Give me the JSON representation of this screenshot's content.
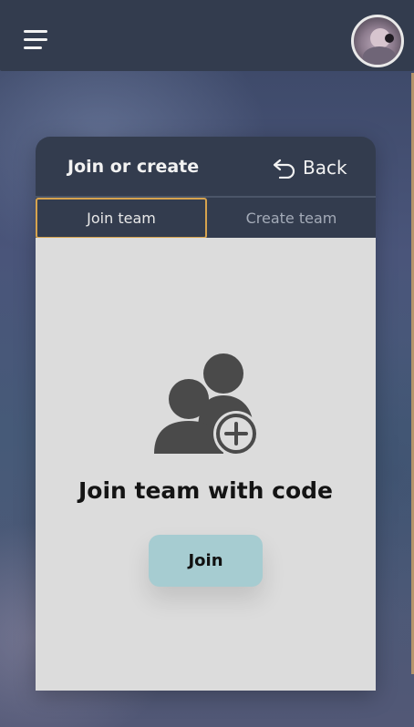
{
  "topbar": {
    "menu_icon": "hamburger-menu-icon",
    "avatar_icon": "user-avatar"
  },
  "panel": {
    "title": "Join or create",
    "back_label": "Back",
    "back_icon": "undo-arrow-icon"
  },
  "tabs": [
    {
      "label": "Join team",
      "active": true
    },
    {
      "label": "Create team",
      "active": false
    }
  ],
  "content": {
    "icon": "add-team-icon",
    "title": "Join team with code",
    "button_label": "Join"
  },
  "colors": {
    "header_bg": "#333c4e",
    "active_tab_border": "#d6a34e",
    "content_bg": "#dcdcdc",
    "join_button_bg": "#a6ccd1"
  }
}
